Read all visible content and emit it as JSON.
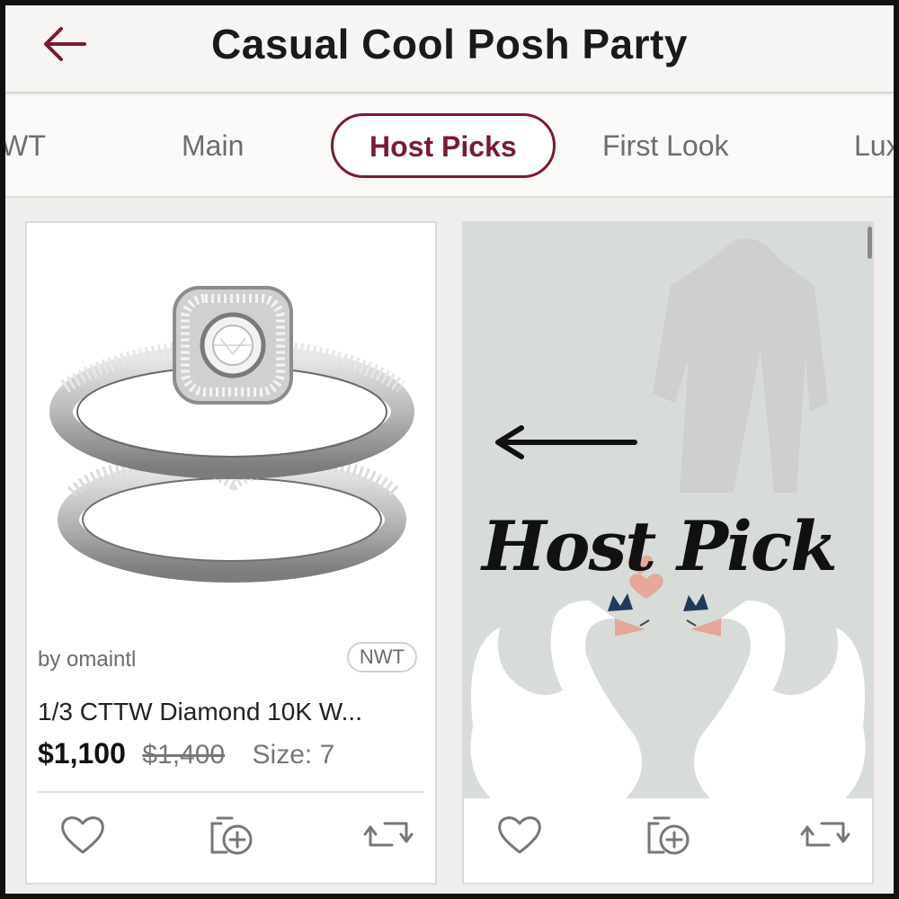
{
  "header": {
    "title": "Casual Cool Posh Party"
  },
  "tabs": [
    {
      "label": "NWT"
    },
    {
      "label": "Main"
    },
    {
      "label": "Host Picks",
      "active": true
    },
    {
      "label": "First Look"
    },
    {
      "label": "Luxury"
    }
  ],
  "listing": {
    "seller": "by omaintl",
    "badge": "NWT",
    "title": "1/3 CTTW Diamond 10K W...",
    "price": "$1,100",
    "original_price": "$1,400",
    "size": "Size: 7"
  },
  "host_pick": {
    "text": "Host Pick"
  },
  "colors": {
    "accent": "#7a1b30",
    "text": "#1a1a1a",
    "muted": "#6d6d6d"
  },
  "icons": [
    "back-arrow-icon",
    "heart-icon",
    "add-to-bundle-icon",
    "share-icon",
    "diamond-ring-image",
    "swan-image"
  ]
}
